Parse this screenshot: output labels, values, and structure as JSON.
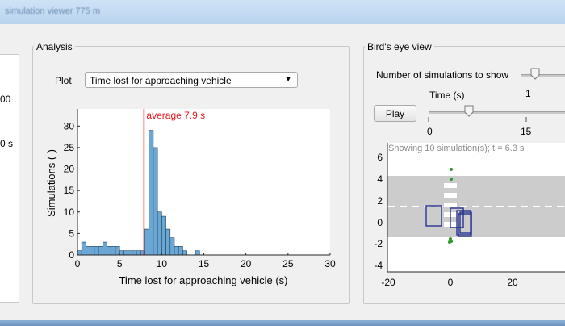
{
  "window": {
    "title": "simulation viewer 775 m"
  },
  "left_panel": {
    "values": [
      "00",
      "0 s"
    ]
  },
  "analysis": {
    "title": "Analysis",
    "plot_label": "Plot",
    "plot_selected": "Time lost for approaching vehicle",
    "chart_data": {
      "type": "bar",
      "ylabel": "Simulations (-)",
      "xlabel": "Time lost for approaching vehicle (s)",
      "xlim": [
        0,
        30
      ],
      "ylim": [
        0,
        34
      ],
      "xticks": [
        "0",
        "5",
        "10",
        "15",
        "20",
        "25",
        "30"
      ],
      "yticks": [
        "0",
        "5",
        "10",
        "15",
        "20",
        "25",
        "30"
      ],
      "bin_width": 0.5,
      "bins": [
        {
          "x": 0.0,
          "v": 1
        },
        {
          "x": 0.5,
          "v": 3
        },
        {
          "x": 1.0,
          "v": 2
        },
        {
          "x": 1.5,
          "v": 2
        },
        {
          "x": 2.0,
          "v": 2
        },
        {
          "x": 2.5,
          "v": 2
        },
        {
          "x": 3.0,
          "v": 3
        },
        {
          "x": 3.5,
          "v": 2
        },
        {
          "x": 4.0,
          "v": 2
        },
        {
          "x": 4.5,
          "v": 2
        },
        {
          "x": 5.0,
          "v": 1
        },
        {
          "x": 5.5,
          "v": 1
        },
        {
          "x": 6.0,
          "v": 1
        },
        {
          "x": 6.5,
          "v": 1
        },
        {
          "x": 7.0,
          "v": 1
        },
        {
          "x": 7.5,
          "v": 1
        },
        {
          "x": 8.0,
          "v": 6
        },
        {
          "x": 8.5,
          "v": 29
        },
        {
          "x": 9.0,
          "v": 25
        },
        {
          "x": 9.5,
          "v": 10
        },
        {
          "x": 10.0,
          "v": 9
        },
        {
          "x": 10.5,
          "v": 6
        },
        {
          "x": 11.0,
          "v": 4
        },
        {
          "x": 11.5,
          "v": 2
        },
        {
          "x": 12.0,
          "v": 2
        },
        {
          "x": 12.5,
          "v": 1
        },
        {
          "x": 14.0,
          "v": 1
        }
      ],
      "average": {
        "value": 7.9,
        "label": "average 7.9 s",
        "color": "#e8191e"
      },
      "bar_color": "#6aa7d4"
    }
  },
  "birdseye": {
    "title": "Bird's eye view",
    "num_sims_label": "Number of simulations to show",
    "num_sims_value": "1",
    "time_label": "Time (s)",
    "play_label": "Play",
    "time_ticks": [
      "0",
      "15"
    ],
    "showing_text": "Showing 10 simulation(s); t = 6.3 s",
    "yticks": [
      "6",
      "4",
      "2",
      "0",
      "-2",
      "-4"
    ],
    "xticks": [
      "-20",
      "0",
      "20"
    ]
  }
}
